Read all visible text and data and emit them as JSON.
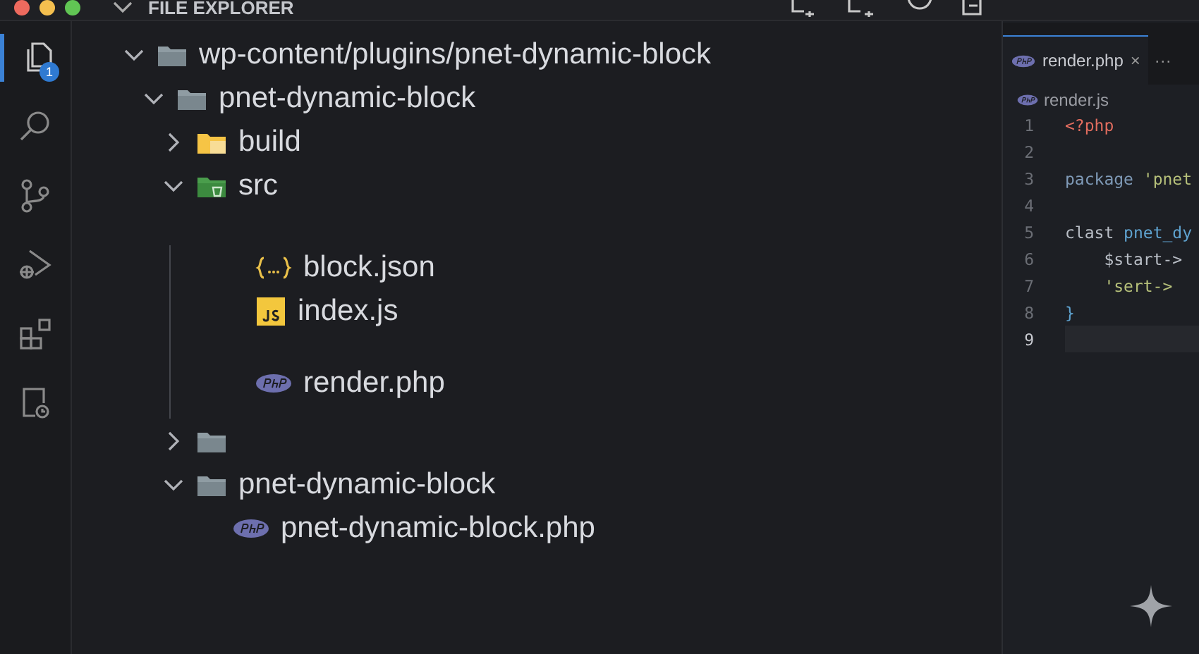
{
  "window": {
    "title": "FILE EXPLORER"
  },
  "activity_bar": [
    {
      "kind": "files",
      "selected": true,
      "badge": "1"
    },
    {
      "kind": "search",
      "selected": false
    },
    {
      "kind": "source-control",
      "selected": false
    },
    {
      "kind": "run-debug",
      "selected": false
    },
    {
      "kind": "extensions",
      "selected": false
    },
    {
      "kind": "remote",
      "selected": false
    }
  ],
  "tree": [
    {
      "label": "wp-content/plugins/pnet-dynamic-block",
      "kind": "folder",
      "expanded": true,
      "children": [
        {
          "label": "pnet-dynamic-block",
          "kind": "folder",
          "expanded": true,
          "children": [
            {
              "label": "build",
              "kind": "build-folder",
              "expanded": false
            },
            {
              "label": "src",
              "kind": "src-folder",
              "expanded": true,
              "children": [
                {
                  "label": "block.json",
                  "kind": "json"
                },
                {
                  "label": "index.js",
                  "kind": "js"
                },
                {
                  "label": "render.php",
                  "kind": "php"
                }
              ]
            },
            {
              "kind": "folder",
              "expanded": false
            },
            {
              "label": "pnet-dynamic-block",
              "kind": "folder",
              "expanded": true,
              "children": [
                {
                  "label": "pnet-dynamic-block.php",
                  "kind": "php"
                }
              ]
            }
          ]
        }
      ]
    }
  ],
  "editor": {
    "tab": {
      "label": "render.php",
      "close": "×",
      "selected": true
    },
    "more": "···",
    "breadcrumb": "render.js",
    "lines": [
      {
        "number": "1",
        "current": false,
        "tokens": [
          {
            "text": "<?php",
            "kind": "tag"
          }
        ]
      },
      {
        "number": "2",
        "current": false
      },
      {
        "number": "3",
        "current": false,
        "tokens": [
          {
            "text": "package ",
            "kind": "keyword"
          },
          {
            "text": "'pnet",
            "kind": "string"
          }
        ]
      },
      {
        "number": "4",
        "current": false
      },
      {
        "number": "5",
        "current": false,
        "tokens": [
          {
            "text": "clast ",
            "kind": "plain"
          },
          {
            "text": "pnet_dy",
            "kind": "name"
          }
        ]
      },
      {
        "number": "6",
        "current": false,
        "tokens": [
          {
            "text": "    $start->",
            "kind": "plain"
          }
        ]
      },
      {
        "number": "7",
        "current": false,
        "tokens": [
          {
            "text": "    'sert->",
            "kind": "string"
          }
        ]
      },
      {
        "number": "8",
        "current": false,
        "tokens": [
          {
            "text": "}",
            "kind": "name"
          }
        ]
      },
      {
        "number": "9",
        "current": true
      }
    ]
  }
}
